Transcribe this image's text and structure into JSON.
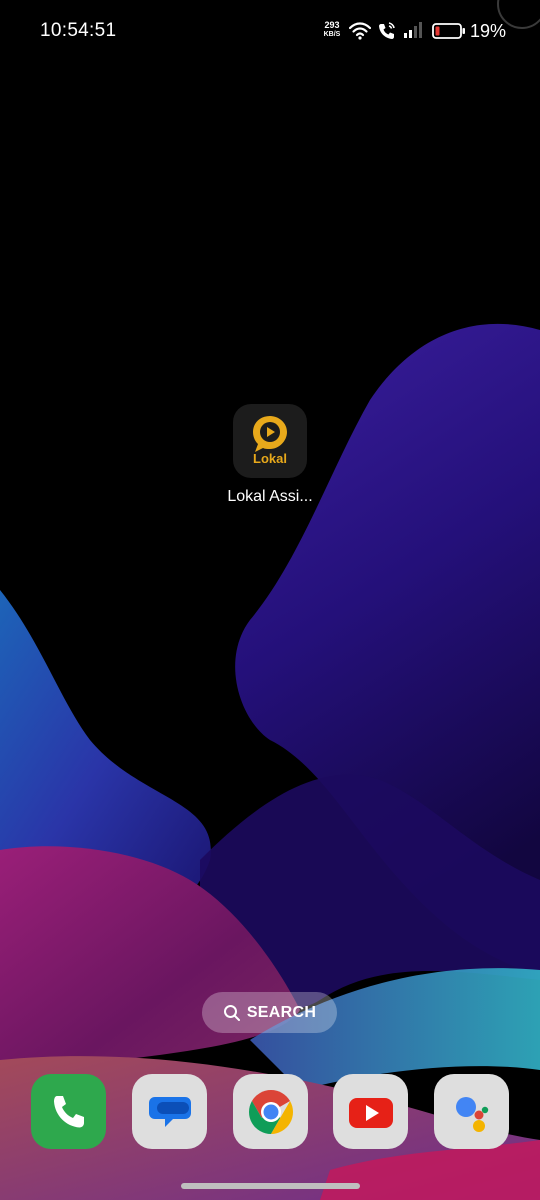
{
  "status_bar": {
    "time": "10:54:51",
    "network_speed_value": "293",
    "network_speed_unit": "KB/S",
    "battery_percent": "19%",
    "icons": [
      "wifi-icon",
      "wifi-call-icon",
      "signal-icon",
      "battery-low-icon"
    ]
  },
  "home": {
    "apps": [
      {
        "label": "Lokal Assi...",
        "icon_text": "Lokal",
        "icon": "lokal-app-icon"
      }
    ]
  },
  "search": {
    "label": "SEARCH",
    "icon": "search-icon"
  },
  "dock": [
    {
      "app": "Phone",
      "icon": "phone-icon"
    },
    {
      "app": "Messages",
      "icon": "messages-icon"
    },
    {
      "app": "Chrome",
      "icon": "chrome-icon"
    },
    {
      "app": "YouTube",
      "icon": "youtube-icon"
    },
    {
      "app": "Assistant",
      "icon": "google-assistant-icon"
    }
  ],
  "colors": {
    "lokal_yellow": "#e8a91b",
    "phone_green": "#2ea84d",
    "youtube_red": "#e62117",
    "battery_low_red": "#e53935"
  }
}
